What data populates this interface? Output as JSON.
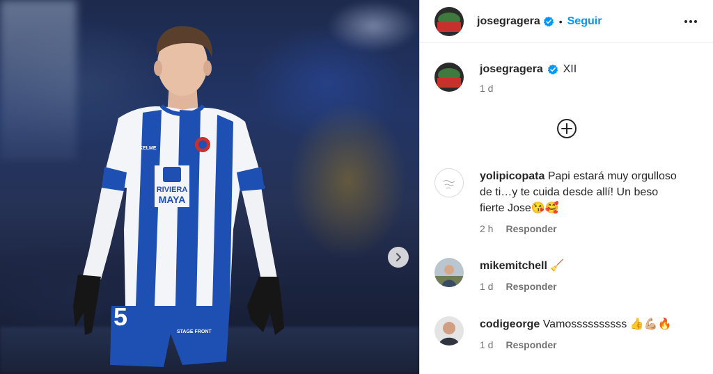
{
  "post": {
    "author": "josegragera",
    "follow_label": "Seguir",
    "separator": "•",
    "caption_text": "XII",
    "caption_time": "1 d"
  },
  "comments": [
    {
      "user": "yolipicopata",
      "lines": [
        "Papi estará muy orgulloso",
        "de ti…y te cuida desde allí! Un beso",
        "fierte Jose😘🥰"
      ],
      "time": "2 h",
      "reply": "Responder"
    },
    {
      "user": "mikemitchell",
      "text": "🧹",
      "time": "1 d",
      "reply": "Responder"
    },
    {
      "user": "codigeorge",
      "text": "Vamossssssssss 👍💪🏼🔥",
      "time": "1 d",
      "reply": "Responder"
    }
  ],
  "jersey": {
    "sponsor_line1": "RIVIERA",
    "sponsor_line2": "MAYA",
    "kit_brand": "KELME",
    "number": "5",
    "shorts_sponsor": "STAGE FRONT"
  },
  "colors": {
    "accent": "#0095f6",
    "verified": "#0095f6",
    "kit_blue": "#1e4fb3"
  }
}
